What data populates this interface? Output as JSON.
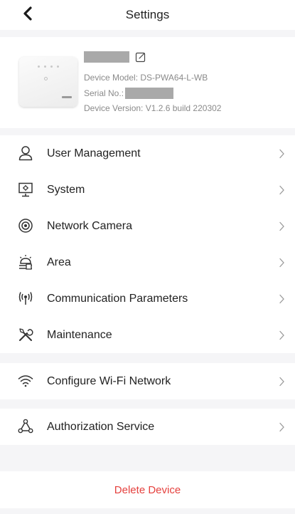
{
  "header": {
    "title": "Settings",
    "back_icon": "chevron-left-icon"
  },
  "device": {
    "model_line": "Device Model: DS-PWA64-L-WB",
    "serial_label": "Serial No.:",
    "version_line": "Device Version: V1.2.6 build 220302",
    "edit_icon": "edit-icon"
  },
  "menu_main": [
    {
      "label": "User Management",
      "icon": "user-icon"
    },
    {
      "label": "System",
      "icon": "system-icon"
    },
    {
      "label": "Network Camera",
      "icon": "camera-icon"
    },
    {
      "label": "Area",
      "icon": "area-icon"
    },
    {
      "label": "Communication Parameters",
      "icon": "signal-icon"
    },
    {
      "label": "Maintenance",
      "icon": "tools-icon"
    }
  ],
  "menu_wifi": [
    {
      "label": "Configure Wi-Fi Network",
      "icon": "wifi-icon"
    }
  ],
  "menu_auth": [
    {
      "label": "Authorization Service",
      "icon": "authorization-icon"
    }
  ],
  "footer": {
    "delete_label": "Delete Device"
  },
  "colors": {
    "background": "#f5f5f7",
    "delete": "#e5413e",
    "secondary_text": "#8a8a8a"
  }
}
